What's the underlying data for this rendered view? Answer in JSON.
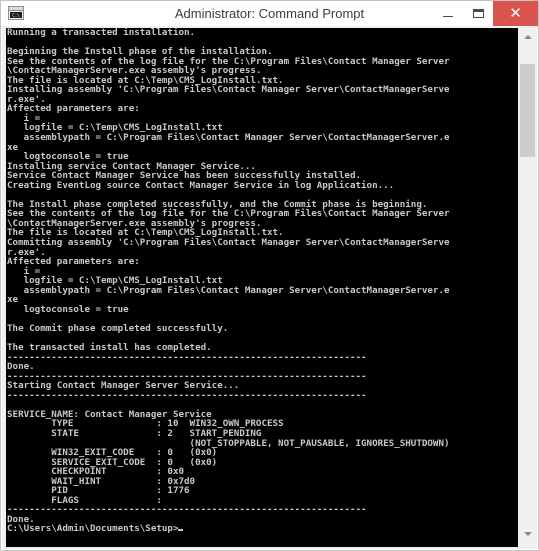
{
  "window": {
    "title": "Administrator: Command Prompt",
    "icon_name": "command-prompt-icon",
    "icon_glyph": "C:\\_",
    "controls": {
      "minimize_label": "",
      "maximize_label": "",
      "close_label": "✕"
    },
    "accent_close_color": "#d9534f",
    "titlebar_bg": "#ffffff",
    "titlebar_text_color": "#3c3c3c"
  },
  "console": {
    "background_color": "#000000",
    "foreground_color": "#c8c8c8",
    "prompt": "C:\\Users\\Admin\\Documents\\Setup>",
    "cursor_visible": true,
    "output": "Running a transacted installation.\n\nBeginning the Install phase of the installation.\nSee the contents of the log file for the C:\\Program Files\\Contact Manager Server\n\\ContactManagerServer.exe assembly's progress.\nThe file is located at C:\\Temp\\CMS_LogInstall.txt.\nInstalling assembly 'C:\\Program Files\\Contact Manager Server\\ContactManagerServe\nr.exe'.\nAffected parameters are:\n   i =\n   logfile = C:\\Temp\\CMS_LogInstall.txt\n   assemblypath = C:\\Program Files\\Contact Manager Server\\ContactManagerServer.e\nxe\n   logtoconsole = true\nInstalling service Contact Manager Service...\nService Contact Manager Service has been successfully installed.\nCreating EventLog source Contact Manager Service in log Application...\n\nThe Install phase completed successfully, and the Commit phase is beginning.\nSee the contents of the log file for the C:\\Program Files\\Contact Manager Server\n\\ContactManagerServer.exe assembly's progress.\nThe file is located at C:\\Temp\\CMS_LogInstall.txt.\nCommitting assembly 'C:\\Program Files\\Contact Manager Server\\ContactManagerServe\nr.exe'.\nAffected parameters are:\n   i =\n   logfile = C:\\Temp\\CMS_LogInstall.txt\n   assemblypath = C:\\Program Files\\Contact Manager Server\\ContactManagerServer.e\nxe\n   logtoconsole = true\n\nThe Commit phase completed successfully.\n\nThe transacted install has completed.\n-----------------------------------------------------------------\nDone.\n-----------------------------------------------------------------\nStarting Contact Manager Server Service...\n-----------------------------------------------------------------\n\nSERVICE_NAME: Contact Manager Service\n        TYPE               : 10  WIN32_OWN_PROCESS\n        STATE              : 2   START_PENDING\n                                 (NOT_STOPPABLE, NOT_PAUSABLE, IGNORES_SHUTDOWN)\n        WIN32_EXIT_CODE    : 0   (0x0)\n        SERVICE_EXIT_CODE  : 0   (0x0)\n        CHECKPOINT         : 0x0\n        WAIT_HINT          : 0x7d0\n        PID                : 1776\n        FLAGS              :\n-----------------------------------------------------------------\nDone.\n"
  },
  "scrollbar": {
    "up_arrow": "˄",
    "down_arrow": "˅",
    "thumb_color": "#cdcdcd",
    "track_color": "#f0f0f0"
  }
}
